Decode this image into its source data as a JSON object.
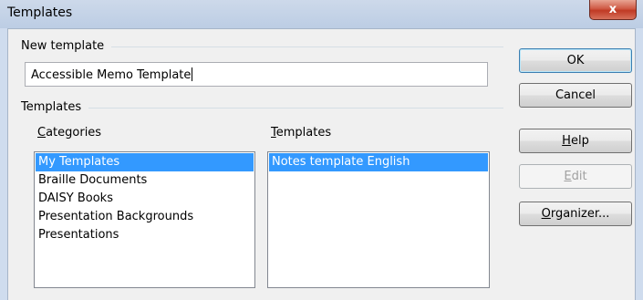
{
  "window": {
    "title": "Templates",
    "close_glyph": "x",
    "close_icon": "close-icon"
  },
  "new_template": {
    "group_label": "New template",
    "name_value": "Accessible Memo Template"
  },
  "templates_group": {
    "group_label": "Templates",
    "categories_label_u": "C",
    "categories_label_rest": "ategories",
    "templates_label_u": "T",
    "templates_label_rest": "emplates",
    "categories": [
      "My Templates",
      "Braille Documents",
      "DAISY Books",
      "Presentation Backgrounds",
      "Presentations"
    ],
    "selected_category": "My Templates",
    "templates": [
      "Notes template English"
    ],
    "selected_template": "Notes template English"
  },
  "buttons": {
    "ok": "OK",
    "cancel": "Cancel",
    "help_u": "H",
    "help_rest": "elp",
    "edit_u": "E",
    "edit_rest": "dit",
    "organizer_u": "O",
    "organizer_rest": "rganizer..."
  },
  "colors": {
    "selection": "#3399ff",
    "close_button": "#c03a24",
    "title_bar": "#c6d4e8"
  }
}
